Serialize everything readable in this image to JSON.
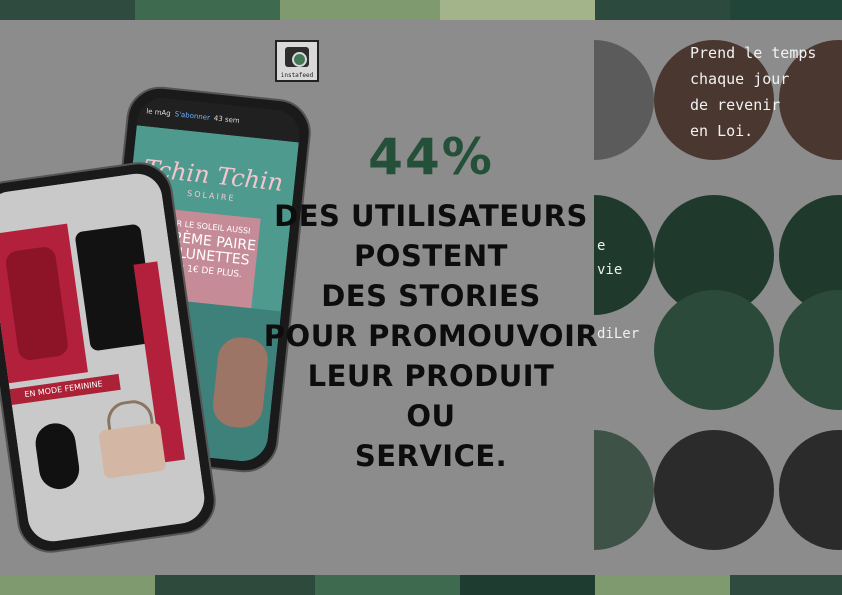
{
  "bands": {
    "top": [
      "#2f4b3f",
      "#3e6b4f",
      "#7f9a6e",
      "#a3b48a",
      "#2d4a3e",
      "#22453a"
    ],
    "bottom": [
      "#7f9a6e",
      "#2e4a3c",
      "#3e6b4f",
      "#1e3d30",
      "#7f9a6e",
      "#2f4b3f"
    ]
  },
  "logo": {
    "text": "instafeed",
    "icon": "camera-icon"
  },
  "headline": {
    "stat": "44%",
    "lines": [
      "des utilisateurs",
      "postent",
      "des stories",
      "pour promouvoir",
      "leur produit",
      "ou",
      "service."
    ]
  },
  "phone_story": {
    "account": "le mAg",
    "follow": "S'abonner",
    "time": "43 sem",
    "brand": "Tchin Tchin",
    "brand_sub": "SOLAIRE",
    "promo_lines": [
      "POUR LE SOLEIL AUSSI",
      "LA 2ÈME PAIRE",
      "DE LUNETTES",
      "POUR 1€ DE PLUS."
    ]
  },
  "phone_shop": {
    "label": "EN MODE FEMININE"
  },
  "collage": {
    "quote_lines": [
      "Prend le temps",
      "chaque jour",
      "de revenir",
      "en Loi."
    ],
    "side_words": [
      "e",
      "vie",
      "diLer"
    ]
  }
}
